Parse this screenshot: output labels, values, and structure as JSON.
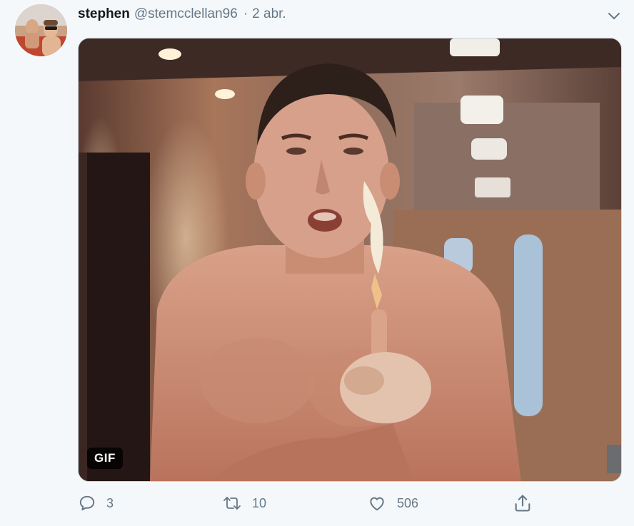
{
  "tweet": {
    "display_name": "stephen",
    "handle": "@stemcclellan96",
    "separator": "·",
    "timestamp": "2 abr.",
    "media_badge": "GIF"
  },
  "actions": {
    "reply_count": "3",
    "retweet_count": "10",
    "like_count": "506"
  },
  "icons": {
    "reply": "reply-icon",
    "retweet": "retweet-icon",
    "like": "heart-icon",
    "share": "share-icon",
    "menu": "chevron-down-icon"
  },
  "colors": {
    "background": "#f5f8fa",
    "text_secondary": "#657786",
    "text_primary": "#14171a"
  }
}
